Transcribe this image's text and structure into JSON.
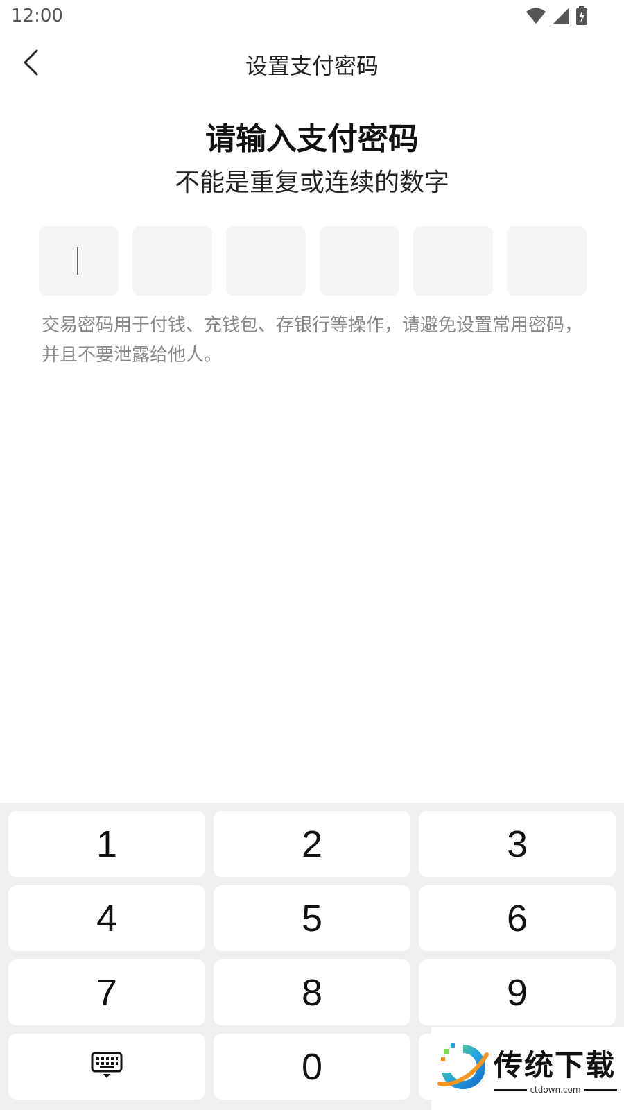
{
  "status_bar": {
    "time": "12:00",
    "icons": [
      "wifi-icon",
      "signal-icon",
      "battery-charging-icon"
    ]
  },
  "header": {
    "title": "设置支付密码",
    "back_icon": "chevron-left-icon"
  },
  "main": {
    "heading": "请输入支付密码",
    "subheading": "不能是重复或连续的数字",
    "pin_length": 6,
    "pin_filled": 0,
    "hint": "交易密码用于付钱、充钱包、存银行等操作，请避免设置常用密码，并且不要泄露给他人。"
  },
  "keypad": {
    "keys": [
      "1",
      "2",
      "3",
      "4",
      "5",
      "6",
      "7",
      "8",
      "9",
      "",
      "0",
      ""
    ],
    "hide_keyboard_icon": "keyboard-hide-icon"
  },
  "watermark": {
    "brand": "传统下载",
    "url": "ctdown.com"
  },
  "colors": {
    "keypad_bg": "#f0f0f2",
    "pin_box_bg": "#f5f5f5",
    "hint_text": "#888888"
  }
}
